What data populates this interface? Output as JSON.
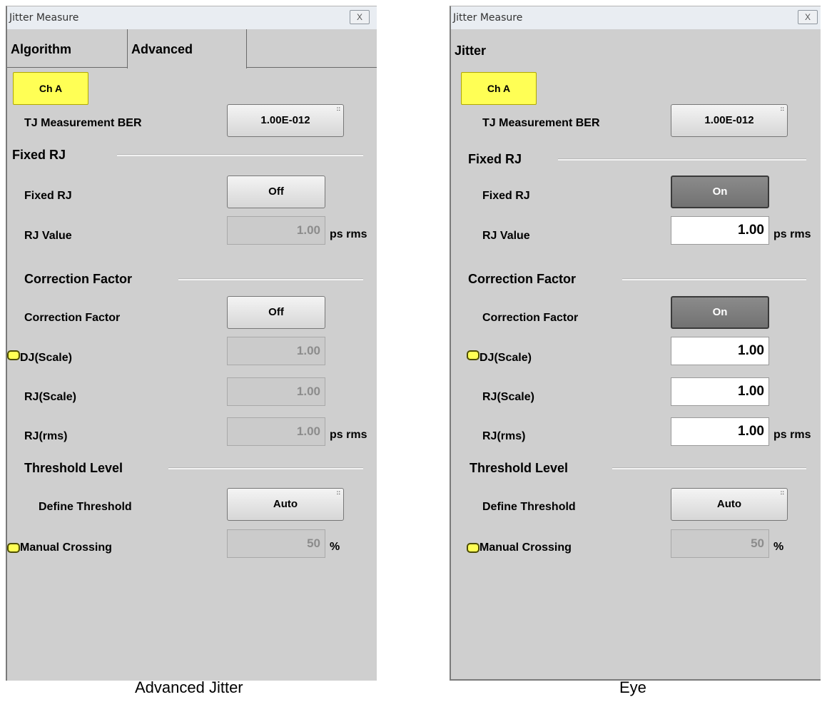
{
  "left": {
    "title": "Jitter Measure",
    "close": "X",
    "tabs": [
      "Algorithm",
      "Advanced"
    ],
    "channel": "Ch A",
    "tj_label": "TJ Measurement BER",
    "tj_value": "1.00E-012",
    "fixed_rj_section": "Fixed RJ",
    "fixed_rj_label": "Fixed RJ",
    "fixed_rj_state": "Off",
    "rj_value_label": "RJ Value",
    "rj_value": "1.00",
    "rj_value_unit": "ps rms",
    "correction_section": "Correction Factor",
    "correction_label": "Correction Factor",
    "correction_state": "Off",
    "dj_scale_label": "DJ(Scale)",
    "dj_scale_value": "1.00",
    "rj_scale_label": "RJ(Scale)",
    "rj_scale_value": "1.00",
    "rj_rms_label": "RJ(rms)",
    "rj_rms_value": "1.00",
    "rj_rms_unit": "ps rms",
    "threshold_section": "Threshold Level",
    "define_threshold_label": "Define Threshold",
    "define_threshold_value": "Auto",
    "manual_crossing_label": "Manual Crossing",
    "manual_crossing_value": "50",
    "manual_crossing_unit": "%"
  },
  "right": {
    "title": "Jitter Measure",
    "close": "X",
    "heading": "Jitter",
    "channel": "Ch A",
    "tj_label": "TJ Measurement BER",
    "tj_value": "1.00E-012",
    "fixed_rj_section": "Fixed RJ",
    "fixed_rj_label": "Fixed RJ",
    "fixed_rj_state": "On",
    "rj_value_label": "RJ Value",
    "rj_value": "1.00",
    "rj_value_unit": "ps rms",
    "correction_section": "Correction Factor",
    "correction_label": "Correction Factor",
    "correction_state": "On",
    "dj_scale_label": "DJ(Scale)",
    "dj_scale_value": "1.00",
    "rj_scale_label": "RJ(Scale)",
    "rj_scale_value": "1.00",
    "rj_rms_label": "RJ(rms)",
    "rj_rms_value": "1.00",
    "rj_rms_unit": "ps rms",
    "threshold_section": "Threshold Level",
    "define_threshold_label": "Define Threshold",
    "define_threshold_value": "Auto",
    "manual_crossing_label": "Manual Crossing",
    "manual_crossing_value": "50",
    "manual_crossing_unit": "%"
  },
  "captions": {
    "left": "Advanced Jitter",
    "right": "Eye"
  },
  "colors": {
    "panel_bg": "#cfcfcf",
    "channel_button": "#ffff55",
    "on_button": "#7a7a7a"
  }
}
